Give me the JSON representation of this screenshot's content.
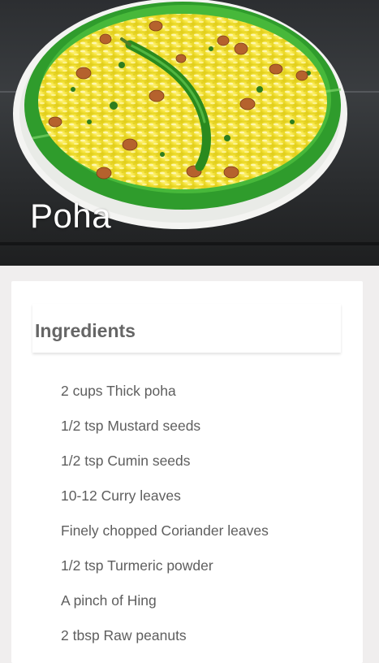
{
  "recipe": {
    "title": "Poha",
    "photo_description": "A plate of yellow poha with peanuts and a green chili on a banana leaf"
  },
  "ingredients_section": {
    "heading": "Ingredients",
    "items": [
      "2 cups Thick poha",
      "1/2 tsp Mustard seeds",
      "1/2 tsp Cumin seeds",
      "10-12 Curry leaves",
      "Finely chopped Coriander leaves",
      "1/2 tsp Turmeric powder",
      "A pinch of Hing",
      "2 tbsp Raw peanuts"
    ]
  }
}
